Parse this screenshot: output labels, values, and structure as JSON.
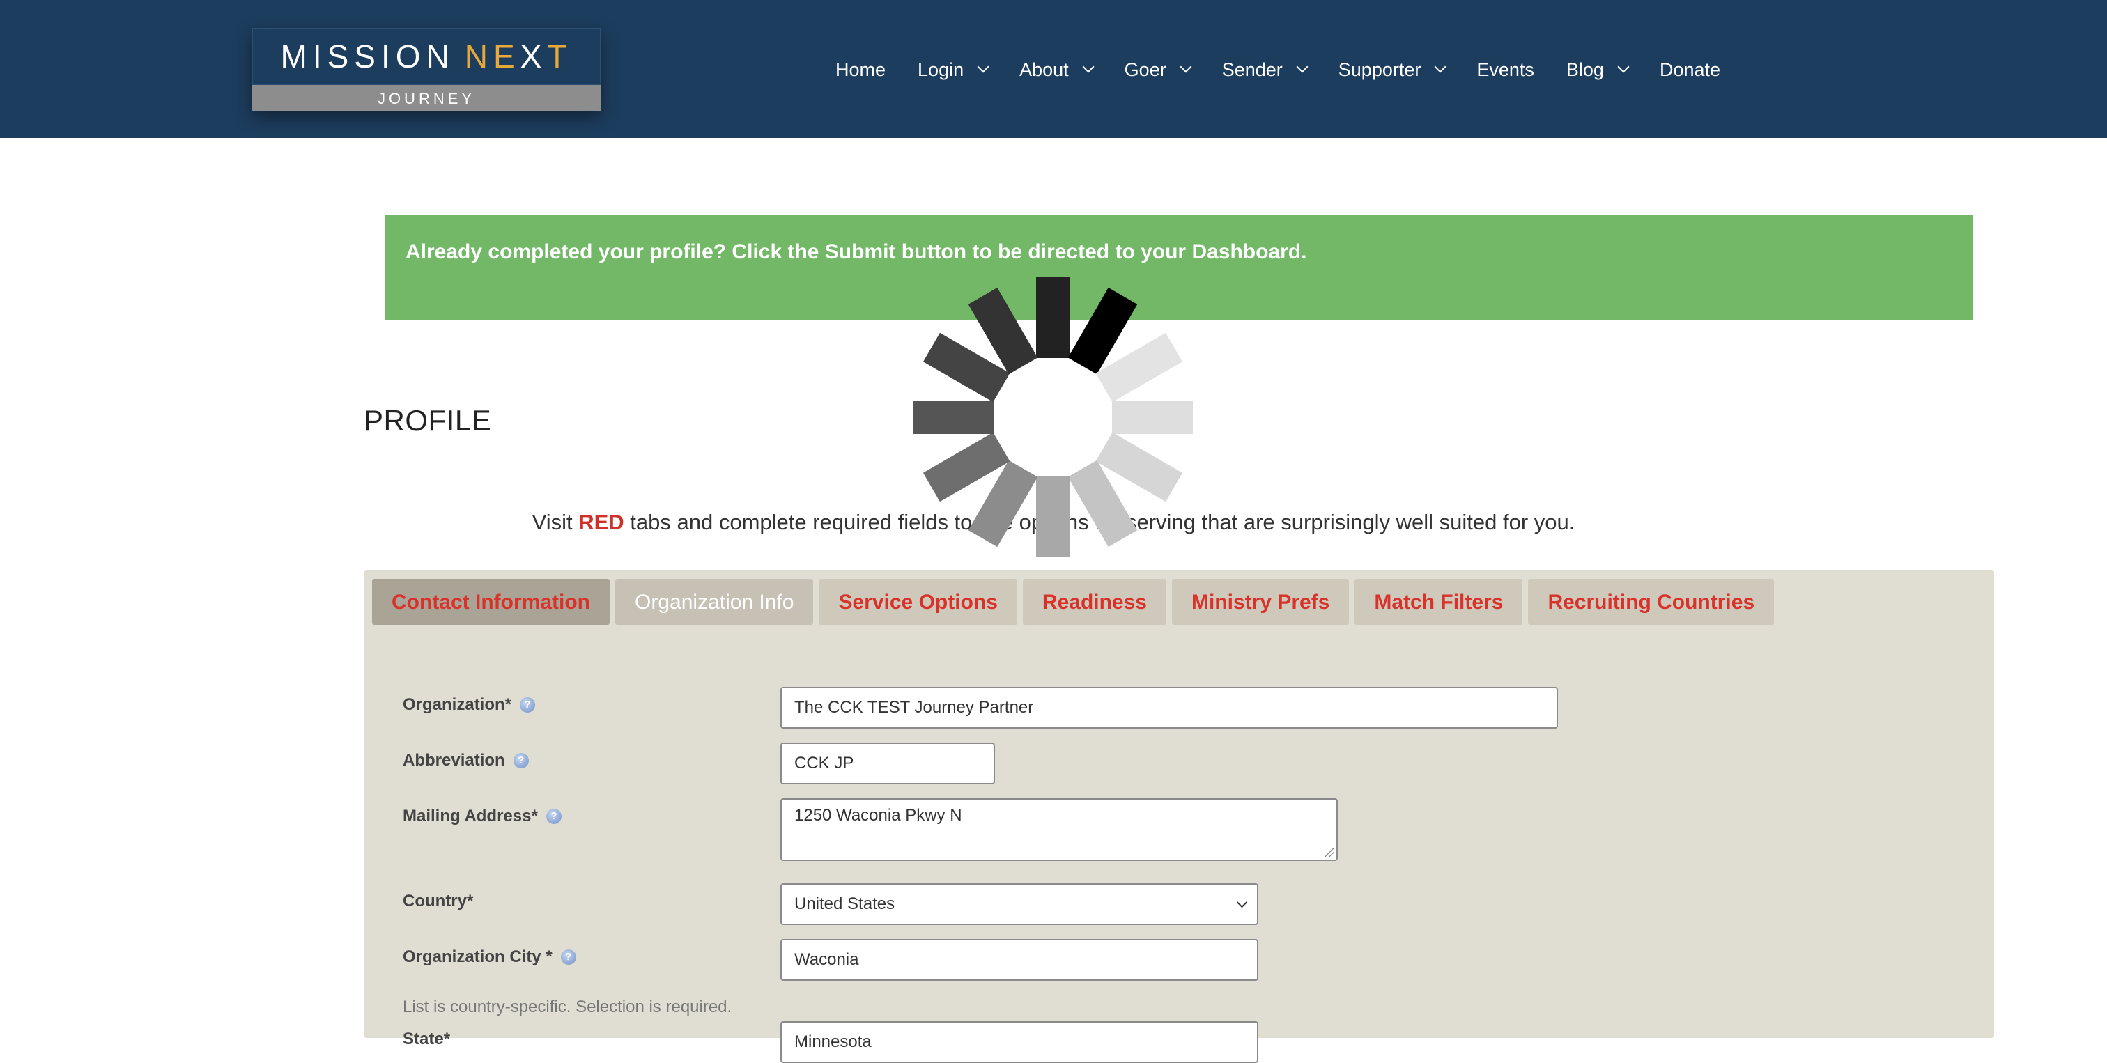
{
  "header": {
    "logo": {
      "word1": "MISSION",
      "word2a": "NE",
      "word2b": "X",
      "word2c": "T",
      "tagline": "JOURNEY"
    },
    "nav": [
      {
        "label": "Home",
        "dropdown": false
      },
      {
        "label": "Login",
        "dropdown": true
      },
      {
        "label": "About",
        "dropdown": true
      },
      {
        "label": "Goer",
        "dropdown": true
      },
      {
        "label": "Sender",
        "dropdown": true
      },
      {
        "label": "Supporter",
        "dropdown": true
      },
      {
        "label": "Events",
        "dropdown": false
      },
      {
        "label": "Blog",
        "dropdown": true
      },
      {
        "label": "Donate",
        "dropdown": false
      }
    ]
  },
  "banner": {
    "text": "Already completed your profile? Click the Submit button to be directed to your Dashboard."
  },
  "page": {
    "title": "PROFILE"
  },
  "intro": {
    "before": "Visit ",
    "red": "RED",
    "after": " tabs and complete required fields to see options for serving that are surprisingly well suited for you."
  },
  "tabs": [
    {
      "label": "Contact Information"
    },
    {
      "label": "Organization Info"
    },
    {
      "label": "Service Options"
    },
    {
      "label": "Readiness"
    },
    {
      "label": "Ministry Prefs"
    },
    {
      "label": "Match Filters"
    },
    {
      "label": "Recruiting Countries"
    }
  ],
  "form": {
    "organization": {
      "label": "Organization*",
      "value": "The CCK TEST Journey Partner"
    },
    "abbreviation": {
      "label": "Abbreviation",
      "value": "CCK JP"
    },
    "mailing_address": {
      "label": "Mailing Address*",
      "value": "1250 Waconia Pkwy N"
    },
    "country": {
      "label": "Country*",
      "value": "United States"
    },
    "city": {
      "label": "Organization City *",
      "value": "Waconia"
    },
    "city_note": "List is country-specific. Selection is required.",
    "state": {
      "label": "State*",
      "value": "Minnesota"
    }
  },
  "help_glyph": "?",
  "colors": {
    "header_bg": "#1d3d5e",
    "banner_bg": "#72b866",
    "panel_bg": "#e0ddd2",
    "tab_red": "#d8322b",
    "logo_accent": "#e6a93a"
  },
  "icons": {
    "spinner": "loading-spinner-icon",
    "help": "help-icon",
    "chevron": "chevron-down-icon"
  }
}
